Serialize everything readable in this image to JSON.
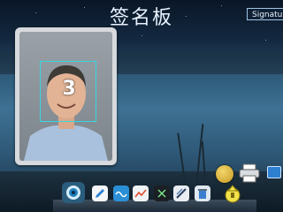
{
  "app": {
    "title": "签名板"
  },
  "toolbar": {
    "signature_label": "Signature"
  },
  "photo": {
    "face_count": "3"
  },
  "dock": {
    "items": [
      {
        "icon": "camera-icon"
      },
      {
        "icon": "pen-icon"
      },
      {
        "icon": "wave-icon"
      },
      {
        "icon": "chart-icon"
      },
      {
        "icon": "sparkle-icon"
      },
      {
        "icon": "brush-icon"
      },
      {
        "icon": "recycle-icon"
      },
      {
        "icon": "upload-icon"
      }
    ]
  },
  "colors": {
    "title": "#e8f2ff",
    "face_box": "#37d7e0",
    "accent": "#2d7fd0"
  }
}
